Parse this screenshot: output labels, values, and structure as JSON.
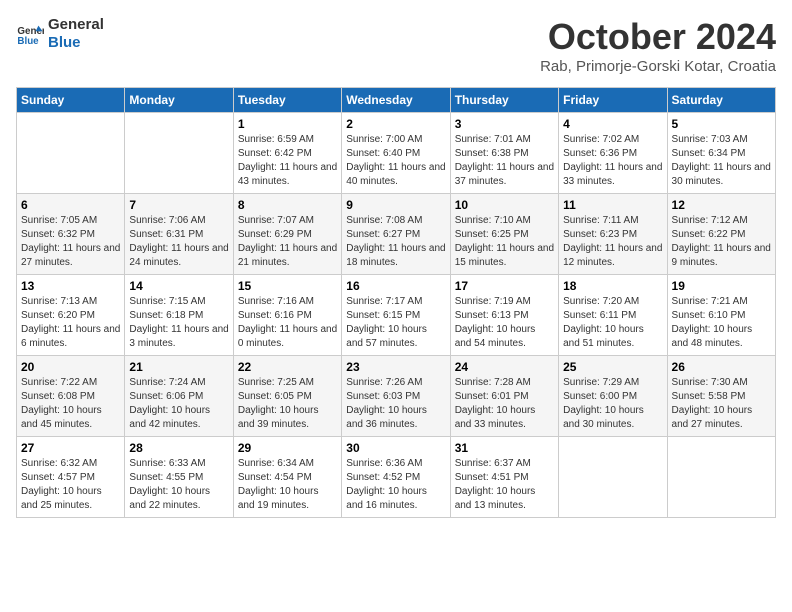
{
  "logo": {
    "line1": "General",
    "line2": "Blue"
  },
  "title": "October 2024",
  "location": "Rab, Primorje-Gorski Kotar, Croatia",
  "headers": [
    "Sunday",
    "Monday",
    "Tuesday",
    "Wednesday",
    "Thursday",
    "Friday",
    "Saturday"
  ],
  "weeks": [
    [
      {
        "day": "",
        "sunrise": "",
        "sunset": "",
        "daylight": ""
      },
      {
        "day": "",
        "sunrise": "",
        "sunset": "",
        "daylight": ""
      },
      {
        "day": "1",
        "sunrise": "Sunrise: 6:59 AM",
        "sunset": "Sunset: 6:42 PM",
        "daylight": "Daylight: 11 hours and 43 minutes."
      },
      {
        "day": "2",
        "sunrise": "Sunrise: 7:00 AM",
        "sunset": "Sunset: 6:40 PM",
        "daylight": "Daylight: 11 hours and 40 minutes."
      },
      {
        "day": "3",
        "sunrise": "Sunrise: 7:01 AM",
        "sunset": "Sunset: 6:38 PM",
        "daylight": "Daylight: 11 hours and 37 minutes."
      },
      {
        "day": "4",
        "sunrise": "Sunrise: 7:02 AM",
        "sunset": "Sunset: 6:36 PM",
        "daylight": "Daylight: 11 hours and 33 minutes."
      },
      {
        "day": "5",
        "sunrise": "Sunrise: 7:03 AM",
        "sunset": "Sunset: 6:34 PM",
        "daylight": "Daylight: 11 hours and 30 minutes."
      }
    ],
    [
      {
        "day": "6",
        "sunrise": "Sunrise: 7:05 AM",
        "sunset": "Sunset: 6:32 PM",
        "daylight": "Daylight: 11 hours and 27 minutes."
      },
      {
        "day": "7",
        "sunrise": "Sunrise: 7:06 AM",
        "sunset": "Sunset: 6:31 PM",
        "daylight": "Daylight: 11 hours and 24 minutes."
      },
      {
        "day": "8",
        "sunrise": "Sunrise: 7:07 AM",
        "sunset": "Sunset: 6:29 PM",
        "daylight": "Daylight: 11 hours and 21 minutes."
      },
      {
        "day": "9",
        "sunrise": "Sunrise: 7:08 AM",
        "sunset": "Sunset: 6:27 PM",
        "daylight": "Daylight: 11 hours and 18 minutes."
      },
      {
        "day": "10",
        "sunrise": "Sunrise: 7:10 AM",
        "sunset": "Sunset: 6:25 PM",
        "daylight": "Daylight: 11 hours and 15 minutes."
      },
      {
        "day": "11",
        "sunrise": "Sunrise: 7:11 AM",
        "sunset": "Sunset: 6:23 PM",
        "daylight": "Daylight: 11 hours and 12 minutes."
      },
      {
        "day": "12",
        "sunrise": "Sunrise: 7:12 AM",
        "sunset": "Sunset: 6:22 PM",
        "daylight": "Daylight: 11 hours and 9 minutes."
      }
    ],
    [
      {
        "day": "13",
        "sunrise": "Sunrise: 7:13 AM",
        "sunset": "Sunset: 6:20 PM",
        "daylight": "Daylight: 11 hours and 6 minutes."
      },
      {
        "day": "14",
        "sunrise": "Sunrise: 7:15 AM",
        "sunset": "Sunset: 6:18 PM",
        "daylight": "Daylight: 11 hours and 3 minutes."
      },
      {
        "day": "15",
        "sunrise": "Sunrise: 7:16 AM",
        "sunset": "Sunset: 6:16 PM",
        "daylight": "Daylight: 11 hours and 0 minutes."
      },
      {
        "day": "16",
        "sunrise": "Sunrise: 7:17 AM",
        "sunset": "Sunset: 6:15 PM",
        "daylight": "Daylight: 10 hours and 57 minutes."
      },
      {
        "day": "17",
        "sunrise": "Sunrise: 7:19 AM",
        "sunset": "Sunset: 6:13 PM",
        "daylight": "Daylight: 10 hours and 54 minutes."
      },
      {
        "day": "18",
        "sunrise": "Sunrise: 7:20 AM",
        "sunset": "Sunset: 6:11 PM",
        "daylight": "Daylight: 10 hours and 51 minutes."
      },
      {
        "day": "19",
        "sunrise": "Sunrise: 7:21 AM",
        "sunset": "Sunset: 6:10 PM",
        "daylight": "Daylight: 10 hours and 48 minutes."
      }
    ],
    [
      {
        "day": "20",
        "sunrise": "Sunrise: 7:22 AM",
        "sunset": "Sunset: 6:08 PM",
        "daylight": "Daylight: 10 hours and 45 minutes."
      },
      {
        "day": "21",
        "sunrise": "Sunrise: 7:24 AM",
        "sunset": "Sunset: 6:06 PM",
        "daylight": "Daylight: 10 hours and 42 minutes."
      },
      {
        "day": "22",
        "sunrise": "Sunrise: 7:25 AM",
        "sunset": "Sunset: 6:05 PM",
        "daylight": "Daylight: 10 hours and 39 minutes."
      },
      {
        "day": "23",
        "sunrise": "Sunrise: 7:26 AM",
        "sunset": "Sunset: 6:03 PM",
        "daylight": "Daylight: 10 hours and 36 minutes."
      },
      {
        "day": "24",
        "sunrise": "Sunrise: 7:28 AM",
        "sunset": "Sunset: 6:01 PM",
        "daylight": "Daylight: 10 hours and 33 minutes."
      },
      {
        "day": "25",
        "sunrise": "Sunrise: 7:29 AM",
        "sunset": "Sunset: 6:00 PM",
        "daylight": "Daylight: 10 hours and 30 minutes."
      },
      {
        "day": "26",
        "sunrise": "Sunrise: 7:30 AM",
        "sunset": "Sunset: 5:58 PM",
        "daylight": "Daylight: 10 hours and 27 minutes."
      }
    ],
    [
      {
        "day": "27",
        "sunrise": "Sunrise: 6:32 AM",
        "sunset": "Sunset: 4:57 PM",
        "daylight": "Daylight: 10 hours and 25 minutes."
      },
      {
        "day": "28",
        "sunrise": "Sunrise: 6:33 AM",
        "sunset": "Sunset: 4:55 PM",
        "daylight": "Daylight: 10 hours and 22 minutes."
      },
      {
        "day": "29",
        "sunrise": "Sunrise: 6:34 AM",
        "sunset": "Sunset: 4:54 PM",
        "daylight": "Daylight: 10 hours and 19 minutes."
      },
      {
        "day": "30",
        "sunrise": "Sunrise: 6:36 AM",
        "sunset": "Sunset: 4:52 PM",
        "daylight": "Daylight: 10 hours and 16 minutes."
      },
      {
        "day": "31",
        "sunrise": "Sunrise: 6:37 AM",
        "sunset": "Sunset: 4:51 PM",
        "daylight": "Daylight: 10 hours and 13 minutes."
      },
      {
        "day": "",
        "sunrise": "",
        "sunset": "",
        "daylight": ""
      },
      {
        "day": "",
        "sunrise": "",
        "sunset": "",
        "daylight": ""
      }
    ]
  ]
}
